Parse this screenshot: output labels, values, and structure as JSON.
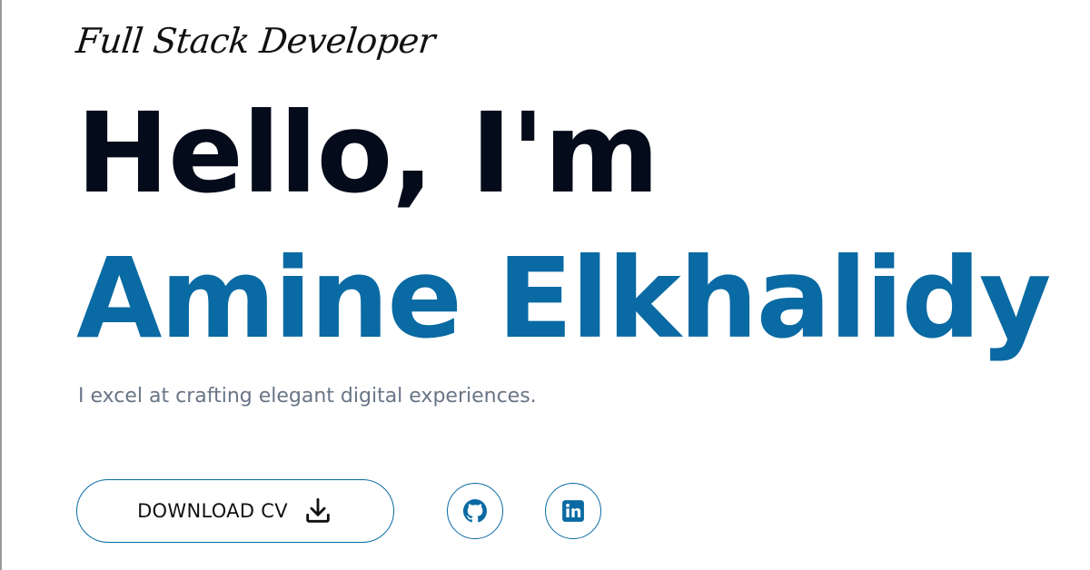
{
  "hero": {
    "tagline": "Full Stack Developer",
    "greeting": "Hello, I'm",
    "name": "Amine Elkhalidy",
    "subtitle": "I excel at crafting elegant digital experiences."
  },
  "actions": {
    "download_cv_label": "DOWNLOAD CV",
    "download_icon": "download-icon"
  },
  "social": [
    {
      "name": "GitHub",
      "icon": "github-icon"
    },
    {
      "name": "LinkedIn",
      "icon": "linkedin-icon"
    }
  ],
  "colors": {
    "accent": "#0a6aa3",
    "heading": "#040b1a",
    "muted_text": "#687586",
    "background": "#ffffff"
  }
}
